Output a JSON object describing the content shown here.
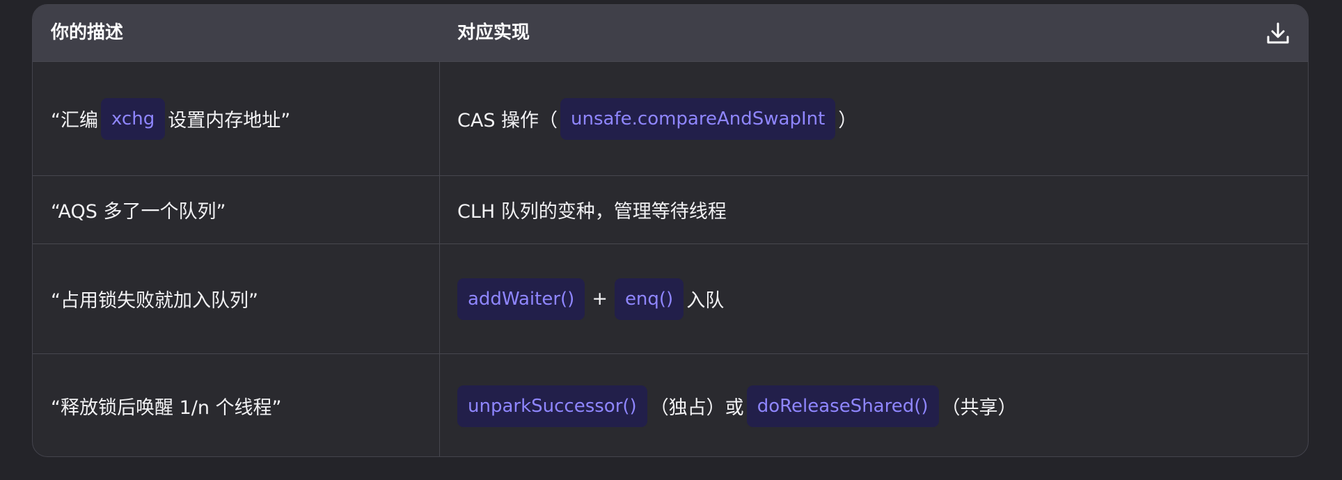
{
  "table": {
    "headers": [
      "你的描述",
      "对应实现"
    ],
    "download_icon": "download-icon",
    "rows": [
      {
        "description": {
          "before": "“汇编",
          "code": "xchg",
          "after": "设置内存地址”"
        },
        "implementation": {
          "before": "CAS 操作（",
          "code": "unsafe.compareAndSwapInt",
          "after": "）"
        }
      },
      {
        "description": {
          "text": "“AQS 多了一个队列”"
        },
        "implementation": {
          "text": "CLH 队列的变种，管理等待线程"
        }
      },
      {
        "description": {
          "text": "“占用锁失败就加入队列”"
        },
        "implementation": {
          "code1": "addWaiter()",
          "mid": "+",
          "code2": "enq()",
          "after": "入队"
        }
      },
      {
        "description": {
          "text": "“释放锁后唤醒 1/n 个线程”"
        },
        "implementation": {
          "code1": "unparkSuccessor()",
          "mid": "（独占）或",
          "code2": "doReleaseShared()",
          "after": "（共享）"
        }
      }
    ]
  },
  "colors": {
    "background": "#242429",
    "header_bg": "#404049",
    "code_bg": "#221f4a",
    "code_text": "#8f86ff"
  }
}
